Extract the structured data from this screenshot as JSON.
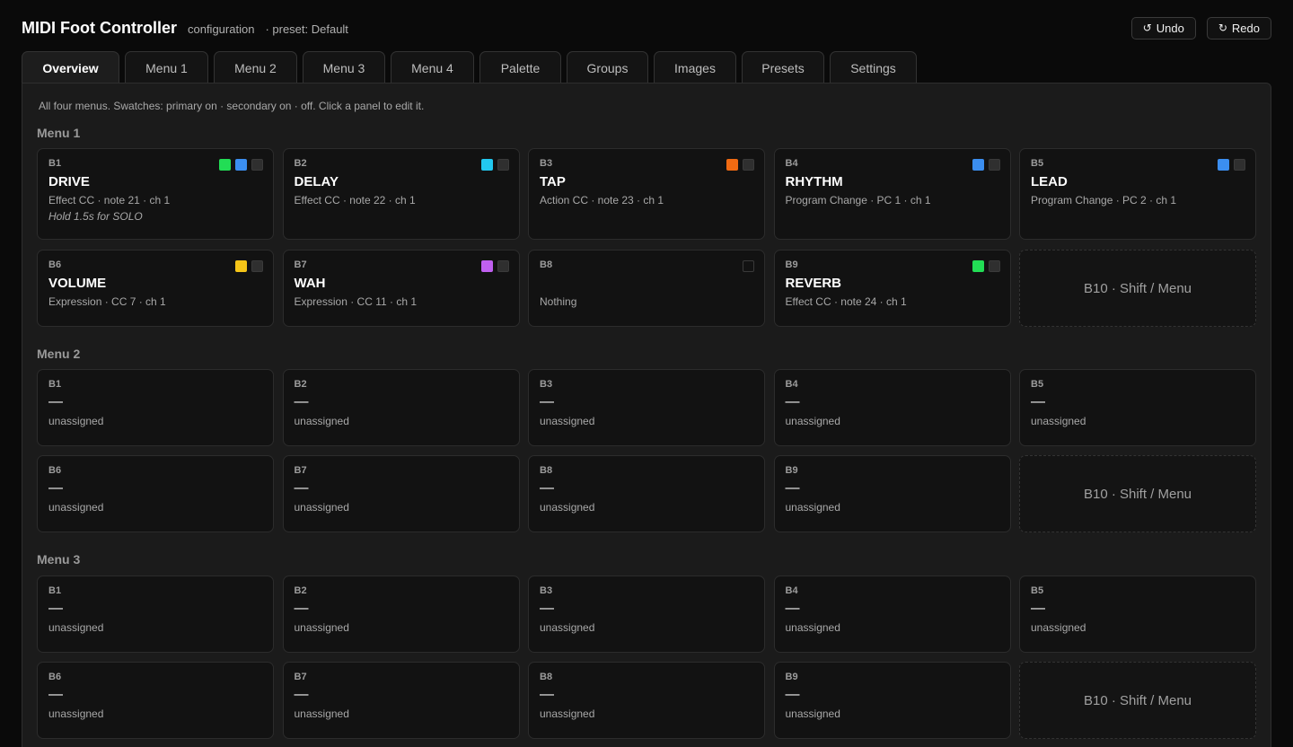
{
  "header": {
    "title": "MIDI Foot Controller",
    "subtitle": "configuration",
    "preset": "· preset: Default",
    "undo_label": "Undo",
    "redo_label": "Redo"
  },
  "tabs": [
    {
      "label": "Overview",
      "active": true
    },
    {
      "label": "Menu 1"
    },
    {
      "label": "Menu 2"
    },
    {
      "label": "Menu 3"
    },
    {
      "label": "Menu 4"
    },
    {
      "label": "Palette"
    },
    {
      "label": "Groups"
    },
    {
      "label": "Images"
    },
    {
      "label": "Presets"
    },
    {
      "label": "Settings"
    }
  ],
  "hint": "All four menus. Swatches: primary on · secondary on · off. Click a panel to edit it.",
  "colors": {
    "green": "#22dd55",
    "blue": "#3b8ef0",
    "cyan": "#22c8f0",
    "orange": "#f06a12",
    "yellow": "#f5c518",
    "purple": "#c060f0"
  },
  "menus": [
    {
      "title": "Menu 1",
      "buttons": [
        {
          "id": "B1",
          "name": "DRIVE",
          "desc": "Effect CC · note 21 · ch 1",
          "note": "Hold 1.5s for SOLO",
          "swatches": [
            "green",
            "blue",
            "off"
          ]
        },
        {
          "id": "B2",
          "name": "DELAY",
          "desc": "Effect CC · note 22 · ch 1",
          "swatches": [
            "cyan",
            "off"
          ]
        },
        {
          "id": "B3",
          "name": "TAP",
          "desc": "Action CC · note 23 · ch 1",
          "swatches": [
            "orange",
            "off"
          ]
        },
        {
          "id": "B4",
          "name": "RHYTHM",
          "desc": "Program Change · PC 1 · ch 1",
          "swatches": [
            "blue",
            "off"
          ]
        },
        {
          "id": "B5",
          "name": "LEAD",
          "desc": "Program Change · PC 2 · ch 1",
          "swatches": [
            "blue",
            "off"
          ]
        },
        {
          "id": "B6",
          "name": "VOLUME",
          "desc": "Expression · CC 7 · ch 1",
          "swatches": [
            "yellow",
            "off"
          ]
        },
        {
          "id": "B7",
          "name": "WAH",
          "desc": "Expression · CC 11 · ch 1",
          "swatches": [
            "purple",
            "off"
          ]
        },
        {
          "id": "B8",
          "name": "",
          "desc": "Nothing",
          "swatches": [
            "outline"
          ]
        },
        {
          "id": "B9",
          "name": "REVERB",
          "desc": "Effect CC · note 24 · ch 1",
          "swatches": [
            "green",
            "off"
          ]
        }
      ],
      "shift_label": "B10 · Shift / Menu"
    },
    {
      "title": "Menu 2",
      "buttons": [
        {
          "id": "B1",
          "name": "—",
          "desc": "unassigned"
        },
        {
          "id": "B2",
          "name": "—",
          "desc": "unassigned"
        },
        {
          "id": "B3",
          "name": "—",
          "desc": "unassigned"
        },
        {
          "id": "B4",
          "name": "—",
          "desc": "unassigned"
        },
        {
          "id": "B5",
          "name": "—",
          "desc": "unassigned"
        },
        {
          "id": "B6",
          "name": "—",
          "desc": "unassigned"
        },
        {
          "id": "B7",
          "name": "—",
          "desc": "unassigned"
        },
        {
          "id": "B8",
          "name": "—",
          "desc": "unassigned"
        },
        {
          "id": "B9",
          "name": "—",
          "desc": "unassigned"
        }
      ],
      "shift_label": "B10 · Shift / Menu"
    },
    {
      "title": "Menu 3",
      "buttons": [
        {
          "id": "B1",
          "name": "—",
          "desc": "unassigned"
        },
        {
          "id": "B2",
          "name": "—",
          "desc": "unassigned"
        },
        {
          "id": "B3",
          "name": "—",
          "desc": "unassigned"
        },
        {
          "id": "B4",
          "name": "—",
          "desc": "unassigned"
        },
        {
          "id": "B5",
          "name": "—",
          "desc": "unassigned"
        },
        {
          "id": "B6",
          "name": "—",
          "desc": "unassigned"
        },
        {
          "id": "B7",
          "name": "—",
          "desc": "unassigned"
        },
        {
          "id": "B8",
          "name": "—",
          "desc": "unassigned"
        },
        {
          "id": "B9",
          "name": "—",
          "desc": "unassigned"
        }
      ],
      "shift_label": "B10 · Shift / Menu"
    }
  ]
}
